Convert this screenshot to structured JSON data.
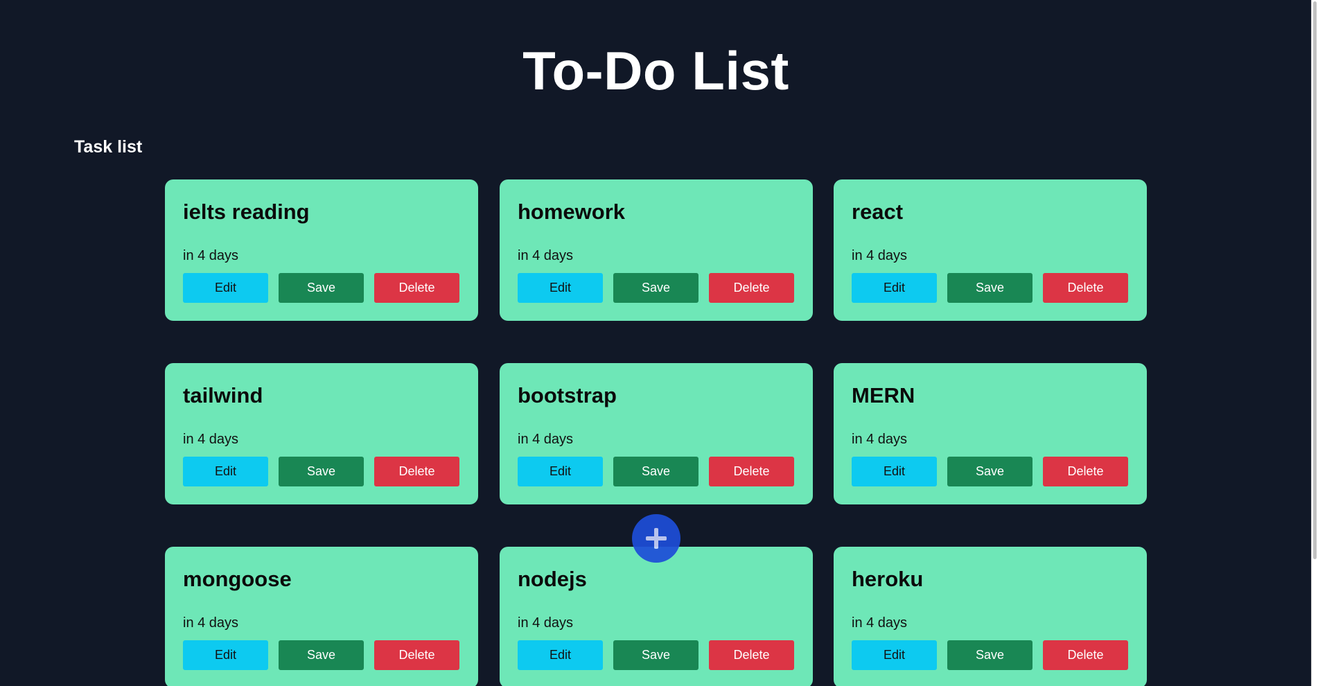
{
  "app": {
    "title": "To-Do List"
  },
  "section": {
    "heading": "Task list"
  },
  "buttons": {
    "edit": "Edit",
    "save": "Save",
    "delete": "Delete"
  },
  "tasks": [
    {
      "title": "ielts reading",
      "due": "in 4 days"
    },
    {
      "title": "homework",
      "due": "in 4 days"
    },
    {
      "title": "react",
      "due": "in 4 days"
    },
    {
      "title": "tailwind",
      "due": "in 4 days"
    },
    {
      "title": "bootstrap",
      "due": "in 4 days"
    },
    {
      "title": "MERN",
      "due": "in 4 days"
    },
    {
      "title": "mongoose",
      "due": "in 4 days"
    },
    {
      "title": "nodejs",
      "due": "in 4 days"
    },
    {
      "title": "heroku",
      "due": "in 4 days"
    }
  ],
  "fab": {
    "icon": "plus-icon"
  },
  "colors": {
    "background": "#111827",
    "card": "#6ee7b7",
    "edit": "#0dcaf0",
    "save": "#198754",
    "delete": "#dc3545",
    "fab": "#1d4ed8"
  }
}
